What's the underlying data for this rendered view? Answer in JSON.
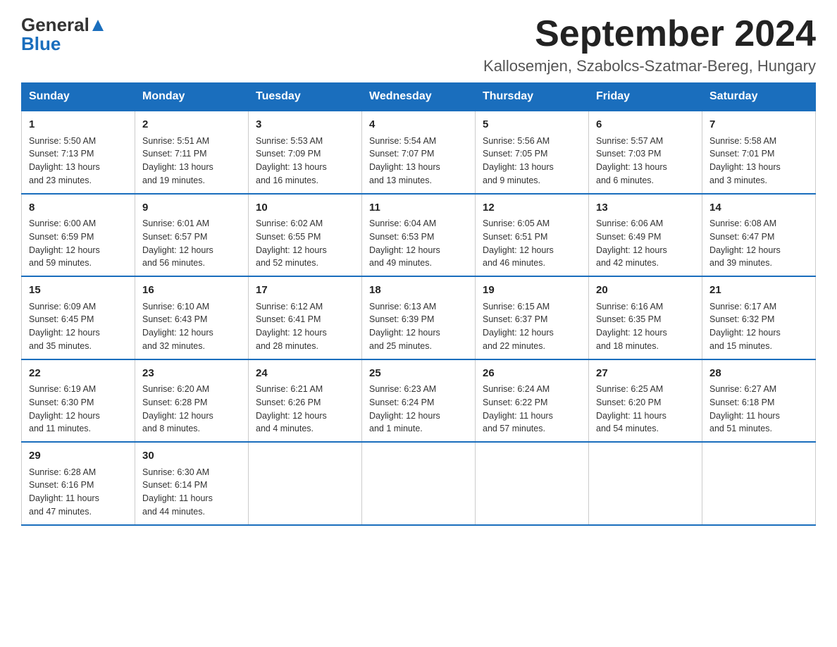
{
  "logo": {
    "general": "General",
    "blue": "Blue"
  },
  "header": {
    "month": "September 2024",
    "location": "Kallosemjen, Szabolcs-Szatmar-Bereg, Hungary"
  },
  "weekdays": [
    "Sunday",
    "Monday",
    "Tuesday",
    "Wednesday",
    "Thursday",
    "Friday",
    "Saturday"
  ],
  "weeks": [
    [
      {
        "day": "1",
        "info": "Sunrise: 5:50 AM\nSunset: 7:13 PM\nDaylight: 13 hours\nand 23 minutes."
      },
      {
        "day": "2",
        "info": "Sunrise: 5:51 AM\nSunset: 7:11 PM\nDaylight: 13 hours\nand 19 minutes."
      },
      {
        "day": "3",
        "info": "Sunrise: 5:53 AM\nSunset: 7:09 PM\nDaylight: 13 hours\nand 16 minutes."
      },
      {
        "day": "4",
        "info": "Sunrise: 5:54 AM\nSunset: 7:07 PM\nDaylight: 13 hours\nand 13 minutes."
      },
      {
        "day": "5",
        "info": "Sunrise: 5:56 AM\nSunset: 7:05 PM\nDaylight: 13 hours\nand 9 minutes."
      },
      {
        "day": "6",
        "info": "Sunrise: 5:57 AM\nSunset: 7:03 PM\nDaylight: 13 hours\nand 6 minutes."
      },
      {
        "day": "7",
        "info": "Sunrise: 5:58 AM\nSunset: 7:01 PM\nDaylight: 13 hours\nand 3 minutes."
      }
    ],
    [
      {
        "day": "8",
        "info": "Sunrise: 6:00 AM\nSunset: 6:59 PM\nDaylight: 12 hours\nand 59 minutes."
      },
      {
        "day": "9",
        "info": "Sunrise: 6:01 AM\nSunset: 6:57 PM\nDaylight: 12 hours\nand 56 minutes."
      },
      {
        "day": "10",
        "info": "Sunrise: 6:02 AM\nSunset: 6:55 PM\nDaylight: 12 hours\nand 52 minutes."
      },
      {
        "day": "11",
        "info": "Sunrise: 6:04 AM\nSunset: 6:53 PM\nDaylight: 12 hours\nand 49 minutes."
      },
      {
        "day": "12",
        "info": "Sunrise: 6:05 AM\nSunset: 6:51 PM\nDaylight: 12 hours\nand 46 minutes."
      },
      {
        "day": "13",
        "info": "Sunrise: 6:06 AM\nSunset: 6:49 PM\nDaylight: 12 hours\nand 42 minutes."
      },
      {
        "day": "14",
        "info": "Sunrise: 6:08 AM\nSunset: 6:47 PM\nDaylight: 12 hours\nand 39 minutes."
      }
    ],
    [
      {
        "day": "15",
        "info": "Sunrise: 6:09 AM\nSunset: 6:45 PM\nDaylight: 12 hours\nand 35 minutes."
      },
      {
        "day": "16",
        "info": "Sunrise: 6:10 AM\nSunset: 6:43 PM\nDaylight: 12 hours\nand 32 minutes."
      },
      {
        "day": "17",
        "info": "Sunrise: 6:12 AM\nSunset: 6:41 PM\nDaylight: 12 hours\nand 28 minutes."
      },
      {
        "day": "18",
        "info": "Sunrise: 6:13 AM\nSunset: 6:39 PM\nDaylight: 12 hours\nand 25 minutes."
      },
      {
        "day": "19",
        "info": "Sunrise: 6:15 AM\nSunset: 6:37 PM\nDaylight: 12 hours\nand 22 minutes."
      },
      {
        "day": "20",
        "info": "Sunrise: 6:16 AM\nSunset: 6:35 PM\nDaylight: 12 hours\nand 18 minutes."
      },
      {
        "day": "21",
        "info": "Sunrise: 6:17 AM\nSunset: 6:32 PM\nDaylight: 12 hours\nand 15 minutes."
      }
    ],
    [
      {
        "day": "22",
        "info": "Sunrise: 6:19 AM\nSunset: 6:30 PM\nDaylight: 12 hours\nand 11 minutes."
      },
      {
        "day": "23",
        "info": "Sunrise: 6:20 AM\nSunset: 6:28 PM\nDaylight: 12 hours\nand 8 minutes."
      },
      {
        "day": "24",
        "info": "Sunrise: 6:21 AM\nSunset: 6:26 PM\nDaylight: 12 hours\nand 4 minutes."
      },
      {
        "day": "25",
        "info": "Sunrise: 6:23 AM\nSunset: 6:24 PM\nDaylight: 12 hours\nand 1 minute."
      },
      {
        "day": "26",
        "info": "Sunrise: 6:24 AM\nSunset: 6:22 PM\nDaylight: 11 hours\nand 57 minutes."
      },
      {
        "day": "27",
        "info": "Sunrise: 6:25 AM\nSunset: 6:20 PM\nDaylight: 11 hours\nand 54 minutes."
      },
      {
        "day": "28",
        "info": "Sunrise: 6:27 AM\nSunset: 6:18 PM\nDaylight: 11 hours\nand 51 minutes."
      }
    ],
    [
      {
        "day": "29",
        "info": "Sunrise: 6:28 AM\nSunset: 6:16 PM\nDaylight: 11 hours\nand 47 minutes."
      },
      {
        "day": "30",
        "info": "Sunrise: 6:30 AM\nSunset: 6:14 PM\nDaylight: 11 hours\nand 44 minutes."
      },
      null,
      null,
      null,
      null,
      null
    ]
  ]
}
